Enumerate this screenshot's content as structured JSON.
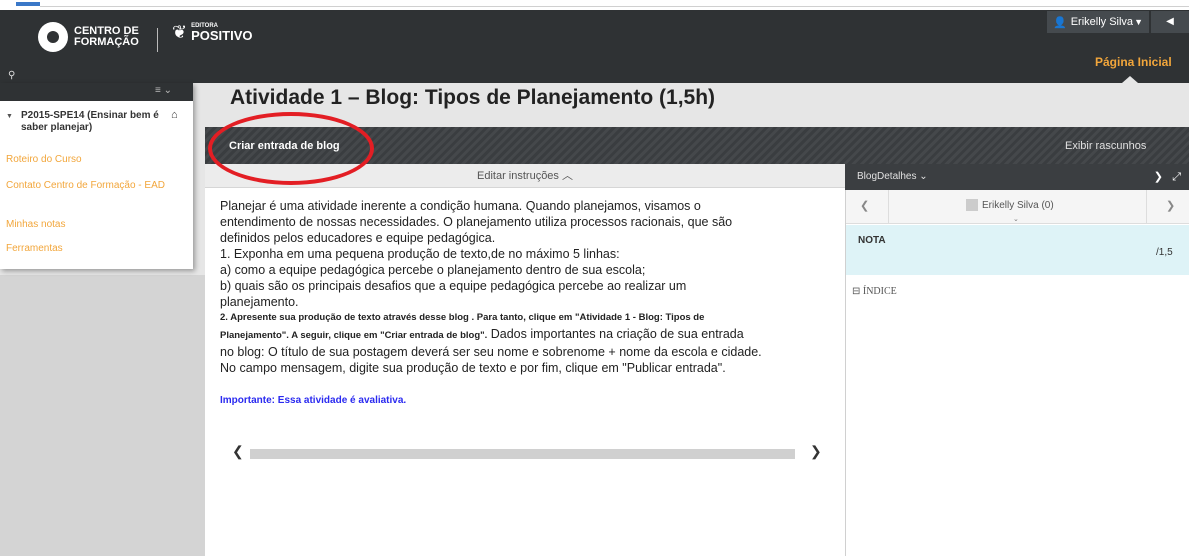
{
  "header": {
    "logo_primary_line1": "CENTRO DE",
    "logo_primary_line2": "FORMAÇÃO",
    "logo_secondary_small": "EDITORA",
    "logo_secondary_big": "POSITIVO",
    "user_name": "Erikelly Silva",
    "home_link": "Página Inicial"
  },
  "page": {
    "title": "Atividade 1 – Blog: Tipos de Planejamento (1,5h)"
  },
  "toolbar": {
    "create_label": "Criar entrada de blog",
    "drafts_label": "Exibir rascunhos"
  },
  "instructions": {
    "edit_label": "Editar instruções",
    "lines": [
      "Planejar é uma atividade inerente a condição humana. Quando planejamos, visamos o",
      "entendimento de nossas necessidades. O planejamento utiliza processos racionais, que são",
      "definidos pelos educadores e equipe pedagógica.",
      "1. Exponha em uma pequena produção de texto,de no máximo 5 linhas:",
      "a) como a equipe pedagógica percebe o planejamento dentro de sua escola;",
      "b) quais são os principais desafios que a equipe pedagógica percebe ao realizar um",
      "planejamento."
    ],
    "step2_bold_line1": "2. Apresente sua produção de texto através desse blog . Para tanto, clique em \"Atividade 1 - Blog: Tipos de",
    "step2_bold_line2": "Planejamento\". A seguir, clique em \"Criar entrada de blog\".",
    "step2_normal_line2": " Dados importantes na criação de sua entrada",
    "step2_line3": "no blog: O título de sua postagem deverá ser seu nome e sobrenome + nome da escola e cidade.",
    "step2_line4": "No campo mensagem, digite sua produção de texto e por fim, clique em \"Publicar entrada\".",
    "important": "Importante: Essa atividade é avaliativa."
  },
  "side_panel": {
    "header_label": "BlogDetalhes",
    "user_entry": "Erikelly Silva (0)",
    "grade_label": "NOTA",
    "grade_value": "/1,5",
    "index_label": "⊟ ÍNDICE"
  },
  "course_menu": {
    "course_name": "P2015-SPE14 (Ensinar bem é saber planejar)",
    "links": [
      "Roteiro do Curso",
      "Contato Centro de Formação - EAD",
      "Minhas notas",
      "Ferramentas"
    ]
  },
  "colors": {
    "accent_orange": "#f2a63b",
    "header_dark": "#2f3234",
    "annotation_red": "#e31e24",
    "important_blue": "#2a2af0",
    "grade_bg": "#def3f7"
  },
  "icons": {
    "user": "user-icon",
    "home": "home-icon",
    "expand": "expand-icon",
    "pin": "pin-icon"
  }
}
